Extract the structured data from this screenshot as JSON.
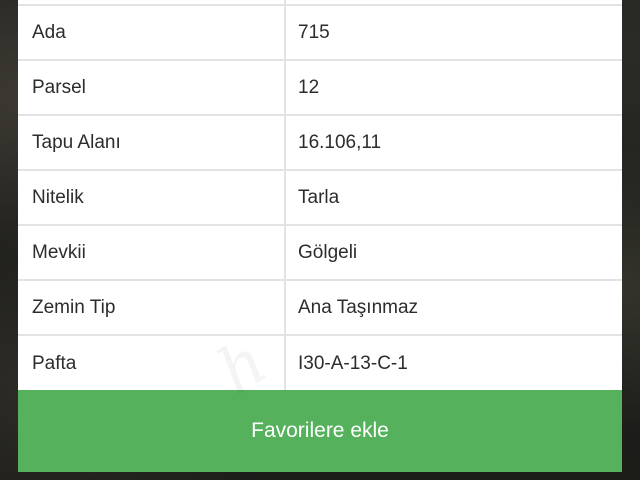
{
  "rows": [
    {
      "label": "Ada",
      "value": "715"
    },
    {
      "label": "Parsel",
      "value": "12"
    },
    {
      "label": "Tapu Alanı",
      "value": "16.106,11"
    },
    {
      "label": "Nitelik",
      "value": "Tarla"
    },
    {
      "label": "Mevkii",
      "value": "Gölgeli"
    },
    {
      "label": "Zemin Tip",
      "value": "Ana Taşınmaz"
    },
    {
      "label": "Pafta",
      "value": "I30-A-13-C-1"
    }
  ],
  "favorite_button": {
    "label": "Favorilere ekle"
  },
  "colors": {
    "button_bg": "#55b15c",
    "button_text": "#ffffff",
    "table_bg": "#ffffff",
    "grid_line": "#e3e3e3",
    "text": "#2c2c2c",
    "background": "#1f1f1c"
  }
}
